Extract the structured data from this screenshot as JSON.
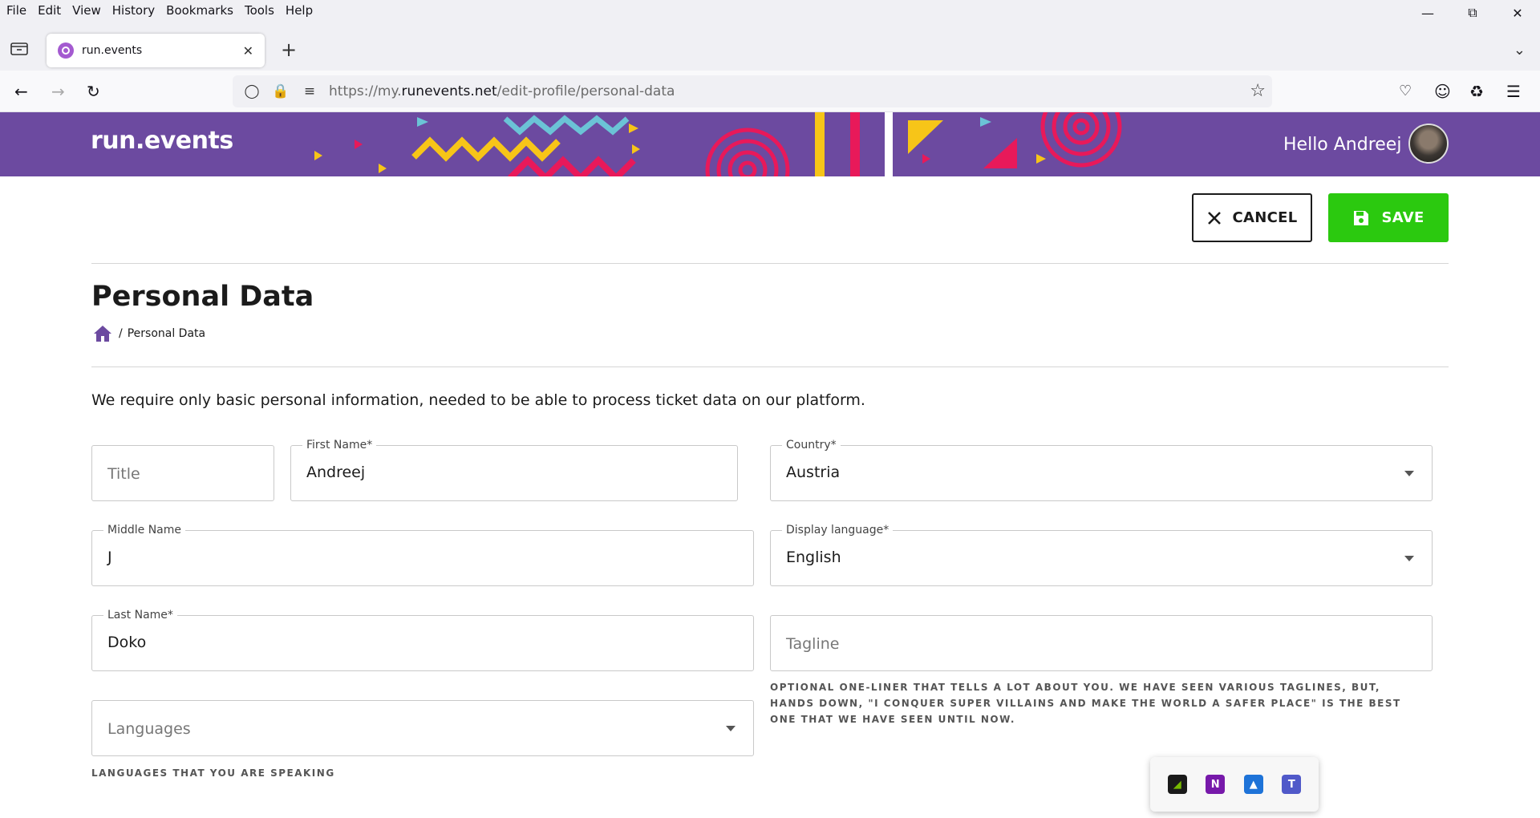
{
  "browser": {
    "menu": [
      "File",
      "Edit",
      "View",
      "History",
      "Bookmarks",
      "Tools",
      "Help"
    ],
    "tab_title": "run.events",
    "url_prefix": "https://my.",
    "url_domain": "runevents.net",
    "url_path": "/edit-profile/personal-data"
  },
  "header": {
    "logo": "run.events",
    "greeting": "Hello Andreej"
  },
  "actions": {
    "cancel_label": "CANCEL",
    "save_label": "SAVE"
  },
  "page": {
    "title": "Personal Data",
    "breadcrumb_current": "Personal Data",
    "intro": "We require only basic personal information, needed to be able to process ticket data on our platform."
  },
  "form": {
    "title": {
      "placeholder": "Title"
    },
    "first_name": {
      "label": "First Name*",
      "value": "Andreej"
    },
    "middle_name": {
      "label": "Middle Name",
      "value": "J"
    },
    "last_name": {
      "label": "Last Name*",
      "value": "Doko"
    },
    "languages": {
      "placeholder": "Languages",
      "help": "LANGUAGES THAT YOU ARE SPEAKING"
    },
    "country": {
      "label": "Country*",
      "value": "Austria"
    },
    "display_language": {
      "label": "Display language*",
      "value": "English"
    },
    "tagline": {
      "placeholder": "Tagline",
      "help": "OPTIONAL ONE-LINER THAT TELLS A LOT ABOUT YOU. WE HAVE SEEN VARIOUS TAGLINES, BUT, HANDS DOWN, \"I CONQUER SUPER VILLAINS AND MAKE THE WORLD A SAFER PLACE\" IS THE BEST ONE THAT WE HAVE SEEN UNTIL NOW."
    }
  },
  "tray_icons": [
    "nvidia-icon",
    "onenote-icon",
    "defender-icon",
    "teams-icon"
  ],
  "colors": {
    "brand": "#6c4aa0",
    "save": "#2bc90f"
  }
}
